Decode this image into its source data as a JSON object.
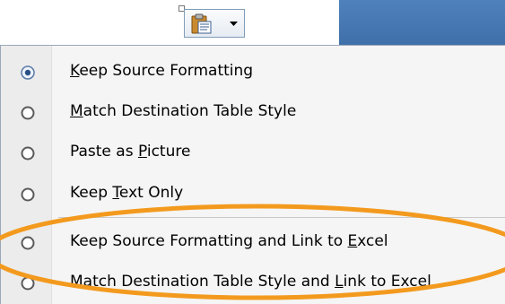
{
  "paste_options_button": {
    "icon": "clipboard-paste-icon",
    "dropdown_icon": "chevron-down-icon"
  },
  "menu": {
    "items": [
      {
        "selected": true,
        "pre": "",
        "mnemonic": "K",
        "post": "eep Source Formatting"
      },
      {
        "selected": false,
        "pre": "",
        "mnemonic": "M",
        "post": "atch Destination Table Style"
      },
      {
        "selected": false,
        "pre": "Paste as ",
        "mnemonic": "P",
        "post": "icture"
      },
      {
        "selected": false,
        "pre": "Keep ",
        "mnemonic": "T",
        "post": "ext Only"
      },
      {
        "selected": false,
        "pre": "Keep Source Formatting and Link to ",
        "mnemonic": "E",
        "post": "xcel"
      },
      {
        "selected": false,
        "pre": "Match Destination Table Style and ",
        "mnemonic": "L",
        "post": "ink to Excel"
      }
    ]
  },
  "highlight": {
    "color": "#f39a1e"
  }
}
